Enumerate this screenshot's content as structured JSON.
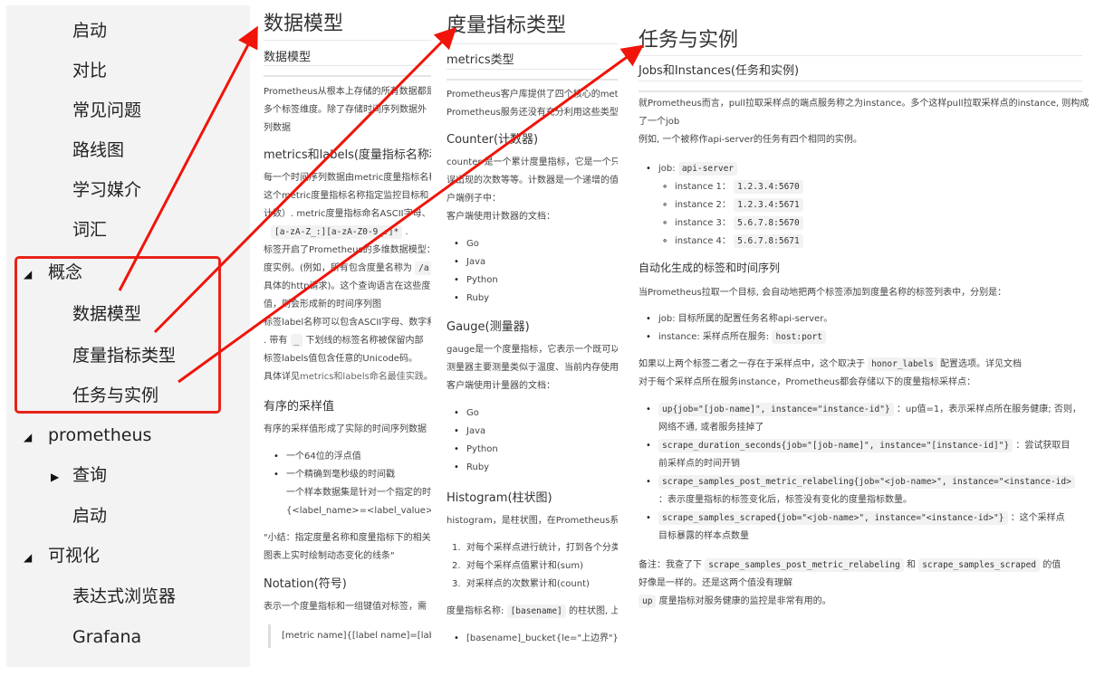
{
  "sidebar": {
    "items": [
      {
        "label": "启动",
        "level": 1
      },
      {
        "label": "对比",
        "level": 1
      },
      {
        "label": "常见问题",
        "level": 1
      },
      {
        "label": "路线图",
        "level": 1
      },
      {
        "label": "学习媒介",
        "level": 1
      },
      {
        "label": "词汇",
        "level": 1
      },
      {
        "label": "概念",
        "level": 0,
        "toggle": "expanded"
      },
      {
        "label": "数据模型",
        "level": 1
      },
      {
        "label": "度量指标类型",
        "level": 1
      },
      {
        "label": "任务与实例",
        "level": 1
      },
      {
        "label": "prometheus",
        "level": 0,
        "toggle": "expanded"
      },
      {
        "label": "查询",
        "level": 1,
        "toggle": "collapsed"
      },
      {
        "label": "启动",
        "level": 1
      },
      {
        "label": "可视化",
        "level": 0,
        "toggle": "expanded"
      },
      {
        "label": "表达式浏览器",
        "level": 1
      },
      {
        "label": "Grafana",
        "level": 1
      }
    ],
    "expanded_glyph": "◢",
    "collapsed_glyph": "▶",
    "highlight_color": "#e8231a"
  },
  "data_model": {
    "title": "数据模型",
    "subtitle": "数据模型",
    "intro": [
      "Prometheus从根本上存储的所有数据都是",
      "多个标签维度。除了存储时间序列数据外",
      "列数据"
    ],
    "section1": "metrics和labels(度量指标名称和标",
    "section1_lines": [
      "每一个时间序列数据由metric度量指标名称",
      "这个metric度量指标名称指定监控目标和",
      "计数）. metric度量指标命名ASCII字母、"
    ],
    "regex_code": "[a-zA-Z_:][a-zA-Z0-9_:]*",
    "regex_suffix": ".",
    "section1_more": [
      "标签开启了Prometheus的多维数据模型：",
      "度实例。(例如，所有包含度量名称为",
      "具体的http请求)。这个查询语言在这些度",
      "值，则会形成新的时间序列图",
      "标签label名称可以包含ASCII字母、数字和"
    ],
    "path_code": "/a",
    "underscore_prefix": ". 带有",
    "underscore_code": "_",
    "underscore_suffix": "下划线的标签名称被保留内部",
    "unicode_line": "标签labels值包含任意的Unicode码。",
    "detail_prefix": "具体详见",
    "detail_link": "metrics和labels命名最佳实践",
    "detail_suffix": "。",
    "section2": "有序的采样值",
    "section2_line": "有序的采样值形成了实际的时间序列数据",
    "section2_bullets": [
      "一个64位的浮点值",
      "一个精确到毫秒级的时间戳"
    ],
    "section2_extra": [
      "一个样本数据集是针对一个指定的时间",
      "{<label_name>=<label_value>, ...}"
    ],
    "summary": [
      "\"小结：指定度量名称和度量指标下的相关",
      "图表上实时绘制动态变化的线条\""
    ],
    "section3": "Notation(符号)",
    "section3_line": "表示一个度量指标和一组键值对标签，需",
    "notation_quote": "[metric name]{[label name]=[label v"
  },
  "metric_types": {
    "title": "度量指标类型",
    "subtitle": "metrics类型",
    "intro": [
      "Prometheus客户库提供了四个核心的metri",
      "Prometheus服务还没有充分利用这些类型。"
    ],
    "counter_title": "Counter(计数器)",
    "counter_lines": [
      "counter 是一个累计度量指标，它是一个只能",
      "误出现的次数等等。计数器是一个递增的值。",
      "户端例子中：",
      "客户端使用计数器的文档："
    ],
    "counter_langs": [
      "Go",
      "Java",
      "Python",
      "Ruby"
    ],
    "gauge_title": "Gauge(测量器)",
    "gauge_lines": [
      "gauge是一个度量指标，它表示一个既可以",
      "测量器主要测量类似于温度、当前内存使用",
      "客户端使用计量器的文档："
    ],
    "gauge_langs": [
      "Go",
      "Java",
      "Python",
      "Ruby"
    ],
    "histogram_title": "Histogram(柱状图)",
    "histogram_line": "histogram，是柱状图，在Prometheus系统",
    "histogram_steps": [
      "对每个采样点进行统计，打到各个分类值",
      "对每个采样点值累计和(sum)",
      "对采样点的次数累计和(count)"
    ],
    "basename_prefix": "度量指标名称:",
    "basename_code": "[basename]",
    "basename_suffix": "的柱状图, 上",
    "bucket_line": "[basename]_bucket{le=\"上边界\"}, 这个"
  },
  "jobs_instances": {
    "title": "任务与实例",
    "subtitle": "Jobs和Instances(任务和实例)",
    "intro": [
      "就Prometheus而言，pull拉取采样点的端点服务称之为instance。多个这样pull拉取采样点的instance, 则构成",
      "了一个job",
      "例如, 一个被称作api-server的任务有四个相同的实例。"
    ],
    "job_label": "job:",
    "job_value": "api-server",
    "instances": [
      {
        "label": "instance 1：",
        "value": "1.2.3.4:5670"
      },
      {
        "label": "instance 2：",
        "value": "1.2.3.4:5671"
      },
      {
        "label": "instance 3：",
        "value": "5.6.7.8:5670"
      },
      {
        "label": "instance 4：",
        "value": "5.6.7.8:5671"
      }
    ],
    "auto_title": "自动化生成的标签和时间序列",
    "auto_line": "当Prometheus拉取一个目标, 会自动地把两个标签添加到度量名称的标签列表中，分别是：",
    "auto_bullets": [
      {
        "text": "job: 目标所属的配置任务名称api-server。"
      },
      {
        "text": "instance: 采样点所在服务:",
        "code": "host:port"
      }
    ],
    "honor_prefix": "如果以上两个标签二者之一存在于采样点中，这个取决于",
    "honor_code": "honor_labels",
    "honor_suffix": "配置选项。详见文档",
    "store_line": "对于每个采样点所在服务instance，Prometheus都会存储以下的度量指标采样点：",
    "metrics": [
      {
        "code": "up{job=\"[job-name]\", instance=\"instance-id\"}",
        "desc": "：up值=1，表示采样点所在服务健康; 否则，",
        "desc2": "网络不通, 或者服务挂掉了"
      },
      {
        "code": "scrape_duration_seconds{job=\"[job-name]\", instance=\"[instance-id]\"}",
        "desc": "：尝试获取目",
        "desc2": "前采样点的时间开销"
      },
      {
        "code": "scrape_samples_post_metric_relabeling{job=\"<job-name>\", instance=\"<instance-id>",
        "desc": "",
        "desc2": "：表示度量指标的标签变化后，标签没有变化的度量指标数量。"
      },
      {
        "code": "scrape_samples_scraped{job=\"<job-name>\", instance=\"<instance-id>\"}",
        "desc": "：这个采样点",
        "desc2": "目标暴露的样本点数量"
      }
    ],
    "note_prefix": "备注：我查了下",
    "note_code1": "scrape_samples_post_metric_relabeling",
    "note_mid": "和",
    "note_code2": "scrape_samples_scraped",
    "note_suffix": "的值",
    "note_line2": "好像是一样的。还是这两个值没有理解",
    "up_code": "up",
    "up_line": "度量指标对服务健康的监控是非常有用的。"
  },
  "annotation": {
    "arrow_color": "#f0140a"
  }
}
